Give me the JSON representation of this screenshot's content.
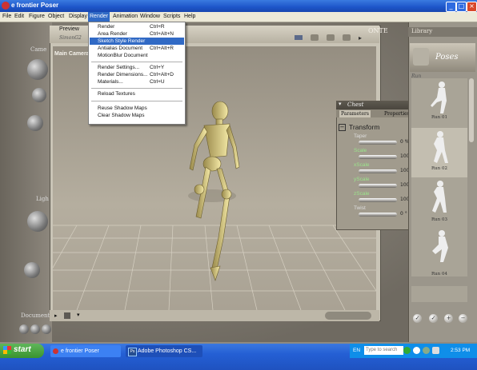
{
  "window": {
    "title": "e frontier Poser"
  },
  "menubar": [
    "File",
    "Edit",
    "Figure",
    "Object",
    "Display",
    "Render",
    "Animation",
    "Window",
    "Scripts",
    "Help"
  ],
  "active_menu": "Render",
  "render_menu": {
    "items": [
      {
        "label": "Render",
        "shortcut": "Ctrl+R"
      },
      {
        "label": "Area Render",
        "shortcut": "Ctrl+Alt+N"
      },
      {
        "label": "Sketch Style Render",
        "shortcut": ""
      },
      {
        "label": "Antialias Document",
        "shortcut": "Ctrl+Alt+R"
      },
      {
        "label": "MotionBlur Document",
        "shortcut": ""
      },
      {
        "label": "Render Settings...",
        "shortcut": "Ctrl+Y"
      },
      {
        "label": "Render Dimensions...",
        "shortcut": "Ctrl+Alt+D"
      },
      {
        "label": "Materials...",
        "shortcut": "Ctrl+U"
      },
      {
        "label": "Reload Textures",
        "shortcut": ""
      },
      {
        "label": "Reuse Shadow Maps",
        "shortcut": ""
      },
      {
        "label": "Clear Shadow Maps",
        "shortcut": ""
      }
    ],
    "highlighted": "Sketch Style Render"
  },
  "document": {
    "preview_tab": "Preview",
    "figure_name": "SimonG2",
    "camera_label": "Main Camera",
    "watermark": "ONTE"
  },
  "left_panel": {
    "camera_label": "Came",
    "light_label": "Ligh",
    "document_label": "Document"
  },
  "chest_panel": {
    "title": "Chest",
    "tabs": [
      "Parameters",
      "Properties"
    ],
    "section": "Transform",
    "params": [
      {
        "name": "Taper",
        "value": "0 %"
      },
      {
        "name": "Scale",
        "value": "100"
      },
      {
        "name": "xScale",
        "value": "100"
      },
      {
        "name": "yScale",
        "value": "100"
      },
      {
        "name": "zScale",
        "value": "100"
      },
      {
        "name": "Twist",
        "value": "0 °"
      }
    ]
  },
  "library": {
    "header": "Library",
    "category": "Poses",
    "folder": "Run",
    "items": [
      {
        "label": "Run 01"
      },
      {
        "label": "Run 02"
      },
      {
        "label": "Run 03"
      },
      {
        "label": "Run 04"
      }
    ],
    "selected_item": "Run 02"
  },
  "taskbar": {
    "start": "start",
    "buttons": [
      "e frontier Poser",
      "Adobe Photoshop CS..."
    ],
    "lang": "EN",
    "search_placeholder": "Type to search",
    "time": "2:53 PM"
  }
}
